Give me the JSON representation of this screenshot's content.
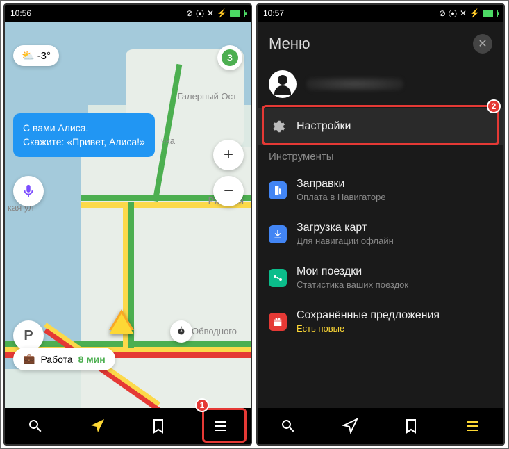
{
  "left": {
    "status_time": "10:56",
    "weather_temp": "-3°",
    "traffic_level": "3",
    "alice_line1": "С вами Алиса.",
    "alice_line2": "Скажите: «Привет, Алиса!»",
    "map_label_top": "Галерный Ост",
    "map_label_right": "Рижский",
    "map_label_center": "наб Обводного",
    "map_label_left": "кая ул",
    "map_label_hidden": "чка",
    "work_label": "Работа",
    "work_time": "8 мин",
    "zoom_in": "+",
    "zoom_out": "−",
    "parking_letter": "P",
    "annotation_badge": "1"
  },
  "right": {
    "status_time": "10:57",
    "menu_title": "Меню",
    "settings_label": "Настройки",
    "section_tools": "Инструменты",
    "fuel_title": "Заправки",
    "fuel_sub": "Оплата в Навигаторе",
    "download_title": "Загрузка карт",
    "download_sub": "Для навигации офлайн",
    "trips_title": "Мои поездки",
    "trips_sub": "Статистика ваших поездок",
    "saved_title": "Сохранённые предложения",
    "saved_sub": "Есть новые",
    "annotation_badge": "2"
  }
}
